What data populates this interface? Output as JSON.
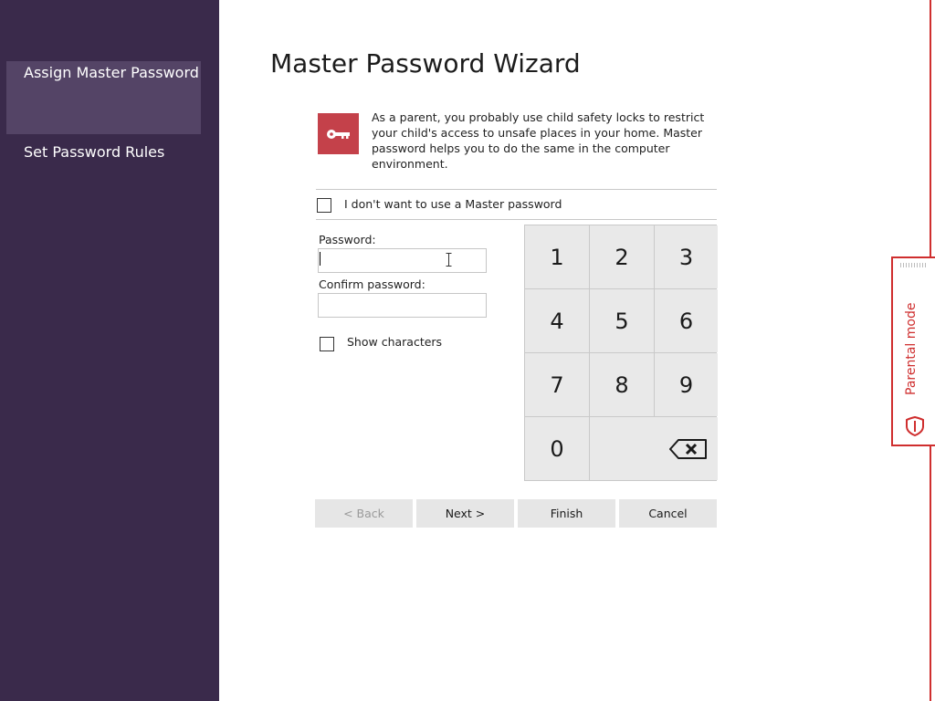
{
  "sidebar": {
    "items": [
      {
        "label": "Assign Master Password",
        "active": true
      },
      {
        "label": "Set Password Rules",
        "active": false
      }
    ]
  },
  "wizard": {
    "title": "Master Password Wizard",
    "intro_icon": "key-icon",
    "intro_text": "As a parent, you probably use child safety locks to restrict your child's access to unsafe places in your home. Master password helps you to do the same in the computer environment.",
    "no_master_label": "I don't want to use a Master password",
    "no_master_checked": false,
    "password_label": "Password:",
    "password_value": "",
    "confirm_label": "Confirm password:",
    "confirm_value": "",
    "show_chars_label": "Show characters",
    "show_chars_checked": false
  },
  "keypad": {
    "keys": [
      "1",
      "2",
      "3",
      "4",
      "5",
      "6",
      "7",
      "8",
      "9",
      "0"
    ],
    "backspace_icon": "backspace-icon"
  },
  "buttons": {
    "back": "< Back",
    "next": "Next >",
    "finish": "Finish",
    "cancel": "Cancel"
  },
  "parental_tab": {
    "label": "Parental mode",
    "icon": "shield-icon"
  },
  "colors": {
    "sidebar_bg": "#3a2a4b",
    "sidebar_active": "#544466",
    "accent_red": "#cf2e2e",
    "key_icon_bg": "#c4414a",
    "keypad_key": "#e9e9e9",
    "button_bg": "#e6e6e6"
  }
}
